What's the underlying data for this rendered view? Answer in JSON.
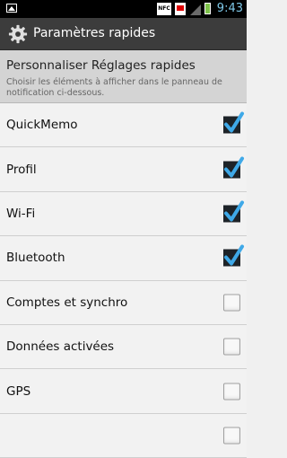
{
  "status_bar": {
    "nfc": "NFC",
    "time": "9:43"
  },
  "header": {
    "title": "Paramètres rapides",
    "icon": "gear-icon"
  },
  "section": {
    "title": "Personnaliser Réglages rapides",
    "description": "Choisir les éléments à afficher dans le panneau de notification ci-dessous."
  },
  "items": [
    {
      "label": "QuickMemo",
      "checked": true
    },
    {
      "label": "Profil",
      "checked": true
    },
    {
      "label": "Wi-Fi",
      "checked": true
    },
    {
      "label": "Bluetooth",
      "checked": true
    },
    {
      "label": "Comptes et synchro",
      "checked": false
    },
    {
      "label": "Données activées",
      "checked": false
    },
    {
      "label": "GPS",
      "checked": false
    },
    {
      "label": "",
      "checked": false
    }
  ],
  "colors": {
    "checkmark": "#3fa9e8",
    "accent_time": "#7ec8e8"
  }
}
